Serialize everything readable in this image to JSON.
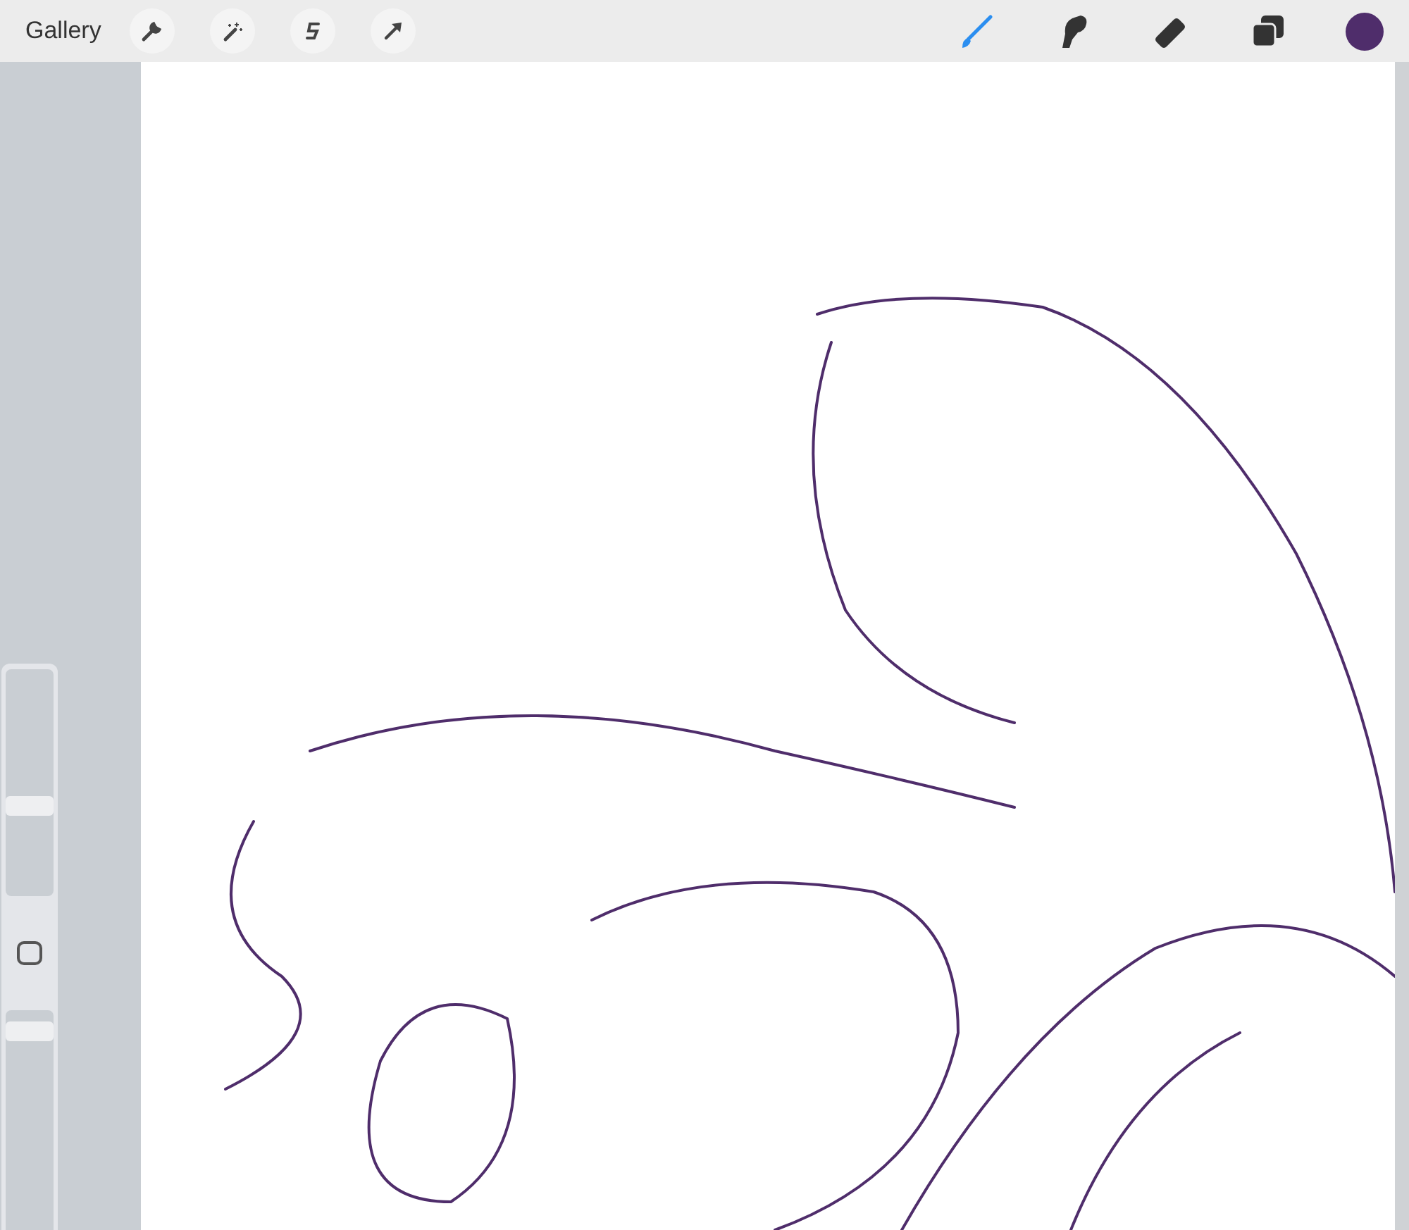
{
  "toolbar": {
    "gallery": "Gallery",
    "actions": [
      {
        "kind": "wrench"
      },
      {
        "kind": "wand"
      },
      {
        "kind": "selection"
      },
      {
        "kind": "arrow"
      }
    ],
    "tools": [
      {
        "kind": "brush",
        "selected": true
      },
      {
        "kind": "smudge",
        "selected": false
      },
      {
        "kind": "eraser",
        "selected": false
      },
      {
        "kind": "layers",
        "selected": false
      }
    ],
    "color": "#4f2d6b"
  },
  "sidebar": {
    "size_slider": {
      "level": 0.39
    },
    "opacity_slider": {
      "level": 0.95
    }
  }
}
